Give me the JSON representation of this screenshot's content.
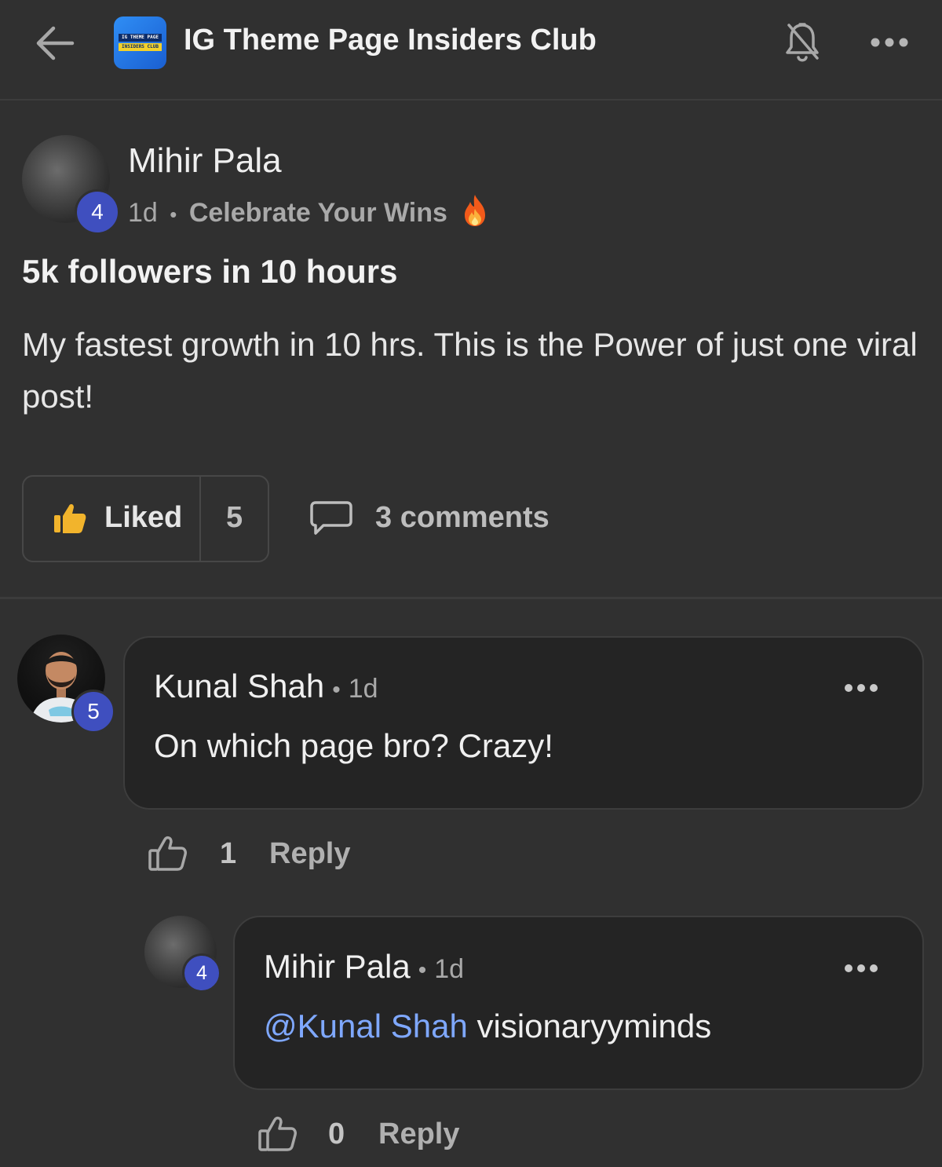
{
  "header": {
    "group_title": "IG Theme Page Insiders Club",
    "logo_line1": "IG THEME PAGE",
    "logo_line2": "INSIDERS CLUB",
    "icons": [
      "back-arrow-icon",
      "bell-off-icon",
      "more-horizontal-icon"
    ]
  },
  "post": {
    "author": "Mihir Pala",
    "level": "4",
    "time": "1d",
    "separator": "•",
    "category": "Celebrate Your Wins",
    "title": "5k followers in 10 hours",
    "body": "My fastest growth in 10 hrs. This is the Power of just one viral post!",
    "liked_label": "Liked",
    "like_count": "5",
    "comments_label": "3 comments"
  },
  "comments": [
    {
      "author": "Kunal Shah",
      "level": "5",
      "time": "1d",
      "text": "On which page bro? Crazy!",
      "likes": "1",
      "reply_label": "Reply"
    }
  ],
  "reply": {
    "author": "Mihir Pala",
    "level": "4",
    "time": "1d",
    "mention": "@Kunal Shah",
    "text": "visionaryyminds",
    "likes": "0",
    "reply_label": "Reply"
  },
  "colors": {
    "background": "#303030",
    "badge": "#3f4fbf",
    "mention": "#7fa8ff",
    "bubble": "#242424"
  }
}
